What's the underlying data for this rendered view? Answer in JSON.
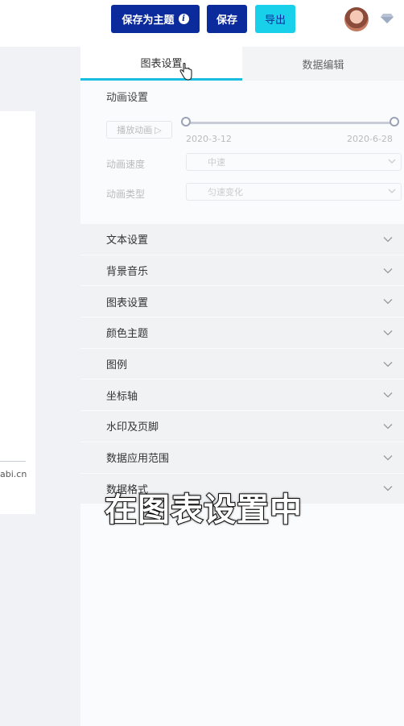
{
  "toolbar": {
    "save_as_theme_label": "保存为主题",
    "info_glyph": "i",
    "save_label": "保存",
    "export_label": "导出"
  },
  "left": {
    "footer_text": "abi.cn"
  },
  "tabs": [
    {
      "label": "图表设置",
      "active": true
    },
    {
      "label": "数据编辑",
      "active": false
    }
  ],
  "animation": {
    "section_title": "动画设置",
    "play_label": "播放动画",
    "start_date": "2020-3-12",
    "end_date": "2020-6-28",
    "speed_label": "动画速度",
    "speed_value": "中速",
    "type_label": "动画类型",
    "type_value": "匀速变化"
  },
  "sections": [
    {
      "label": "文本设置"
    },
    {
      "label": "背景音乐"
    },
    {
      "label": "图表设置"
    },
    {
      "label": "颜色主题"
    },
    {
      "label": "图例"
    },
    {
      "label": "坐标轴"
    },
    {
      "label": "水印及页脚"
    },
    {
      "label": "数据应用范围"
    },
    {
      "label": "数据格式"
    }
  ],
  "caption": "在图表设置中",
  "colors": {
    "primary": "#0b2a9b",
    "accent": "#19d0ea",
    "tab_underline": "#19bde0"
  }
}
